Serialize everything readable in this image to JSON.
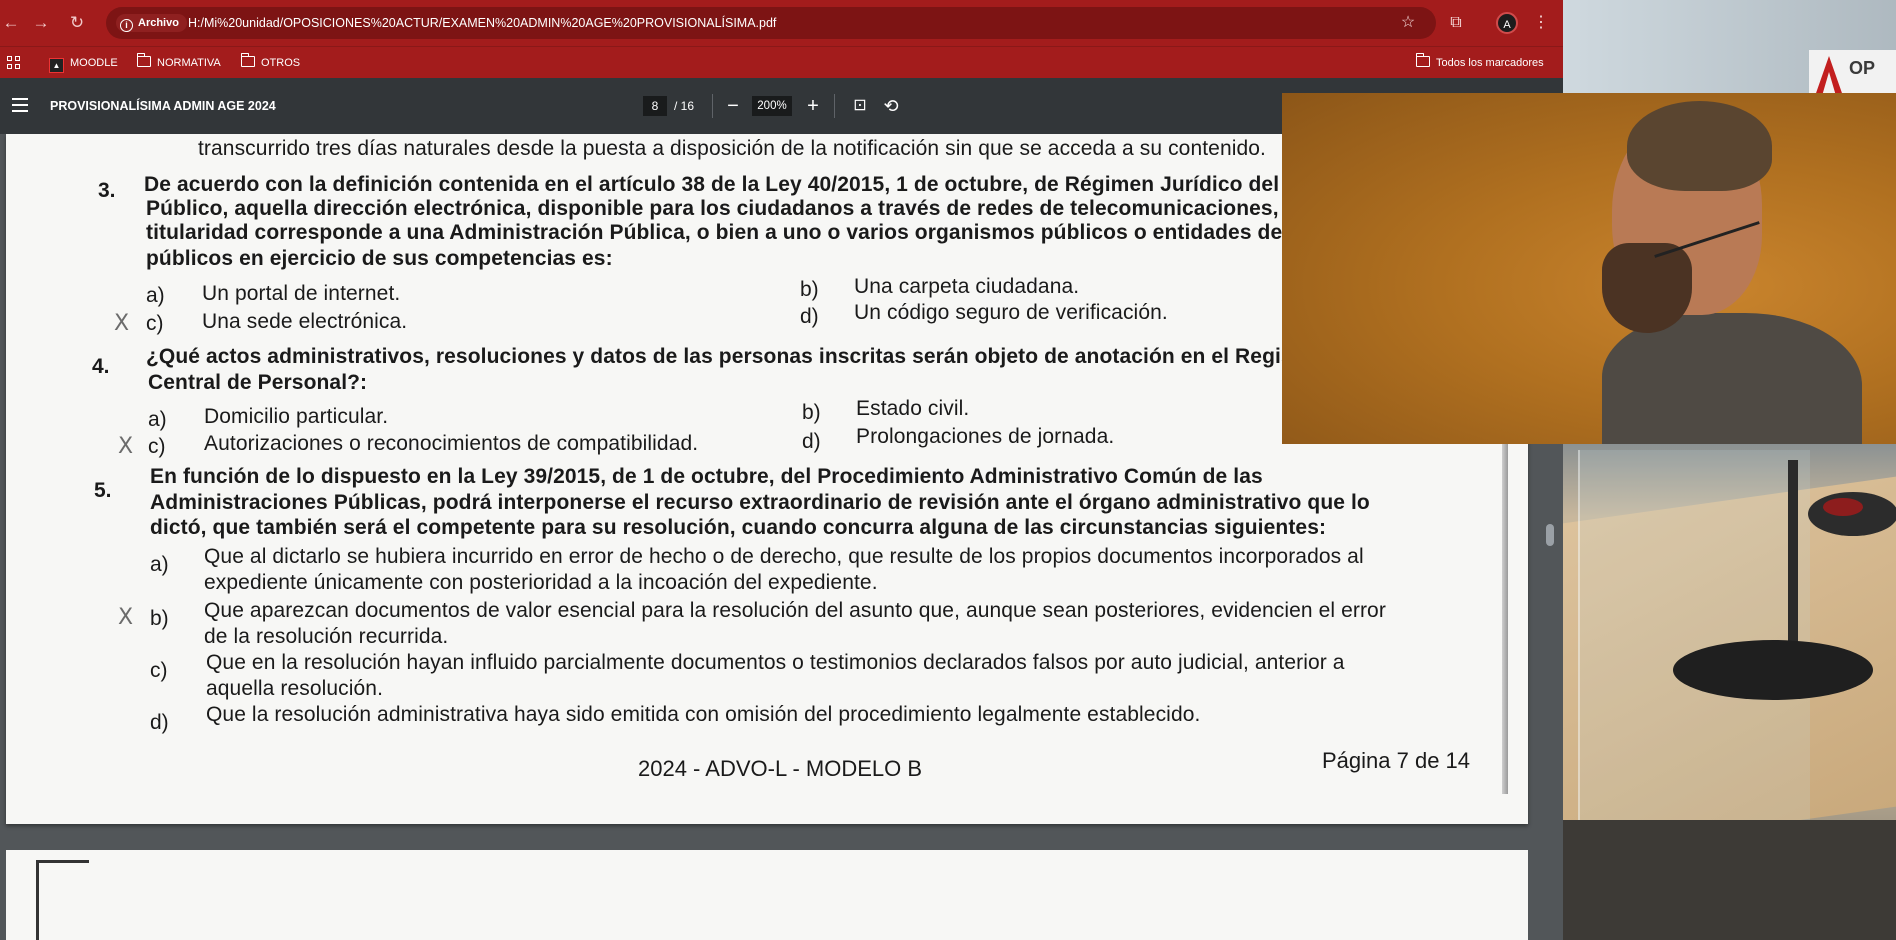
{
  "browser": {
    "url_chip": "Archivo",
    "url": "H:/Mi%20unidad/OPOSICIONES%20ACTUR/EXAMEN%20ADMIN%20AGE%20PROVISIONALÍSIMA.pdf",
    "icons": [
      "back-icon",
      "forward-icon",
      "reload-icon",
      "info-icon",
      "star-icon",
      "extensions-icon",
      "profile-icon",
      "menu-icon"
    ],
    "profile_initial": "A"
  },
  "bookmarks": {
    "items": [
      {
        "label": "MOODLE",
        "icon": "moodle-icon"
      },
      {
        "label": "NORMATIVA",
        "icon": "folder-icon"
      },
      {
        "label": "OTROS",
        "icon": "folder-icon"
      }
    ],
    "all_bookmarks": "Todos los marcadores"
  },
  "pdf_toolbar": {
    "title": "PROVISIONALÍSIMA ADMIN AGE 2024",
    "current_page": "8",
    "total_pages": "/ 16",
    "zoom": "200%",
    "icons": [
      "hamburger-icon",
      "zoom-out-icon",
      "zoom-in-icon",
      "fit-page-icon",
      "rotate-icon"
    ]
  },
  "document": {
    "prev_line": "transcurrido tres días naturales desde la puesta a disposición de la notificación sin que se acceda a su contenido.",
    "q3": {
      "number": "3.",
      "lines": [
        "De acuerdo con la definición contenida en el artículo 38 de la Ley 40/2015, 1 de octubre, de Régimen Jurídico del Sector",
        "Público, aquella dirección electrónica, disponible para los ciudadanos a través de redes de telecomunicaciones, cuya",
        "titularidad corresponde a una Administración Pública, o bien a uno o varios organismos públicos o entidades de Derecho",
        "públicos en ejercicio de sus competencias es:"
      ],
      "options": [
        {
          "letter": "a)",
          "text": "Un portal de internet."
        },
        {
          "letter": "b)",
          "text": "Una carpeta ciudadana."
        },
        {
          "letter": "c)",
          "text": "Una sede electrónica."
        },
        {
          "letter": "d)",
          "text": "Un código seguro de verificación."
        }
      ],
      "mark": "X"
    },
    "q4": {
      "number": "4.",
      "lines": [
        "¿Qué actos administrativos, resoluciones y datos de las personas inscritas serán objeto de anotación en el Registro",
        "Central de Personal?:"
      ],
      "options": [
        {
          "letter": "a)",
          "text": "Domicilio particular."
        },
        {
          "letter": "b)",
          "text": "Estado civil."
        },
        {
          "letter": "c)",
          "text": "Autorizaciones o reconocimientos de compatibilidad."
        },
        {
          "letter": "d)",
          "text": "Prolongaciones de jornada."
        }
      ],
      "mark": "X"
    },
    "q5": {
      "number": "5.",
      "lines": [
        "En función de lo dispuesto en la Ley 39/2015, de 1 de octubre, del Procedimiento Administrativo Común de las",
        "Administraciones Públicas, podrá interponerse el recurso extraordinario de revisión ante el órgano administrativo que lo",
        "dictó, que también será el competente para su resolución, cuando concurra alguna de las circunstancias siguientes:"
      ],
      "options": [
        {
          "letter": "a)",
          "lines": [
            "Que al dictarlo se hubiera incurrido en error de hecho o de derecho, que resulte de los propios documentos incorporados al",
            "expediente únicamente con posterioridad a la incoación del expediente."
          ]
        },
        {
          "letter": "b)",
          "lines": [
            "Que aparezcan documentos de valor esencial para la resolución del asunto que, aunque sean posteriores, evidencien el error",
            "de la resolución recurrida."
          ]
        },
        {
          "letter": "c)",
          "lines": [
            "Que en la resolución hayan influido parcialmente documentos o testimonios declarados falsos por auto judicial, anterior a",
            "aquella resolución."
          ]
        },
        {
          "letter": "d)",
          "lines": [
            "Que la resolución administrativa haya sido emitida con omisión del procedimiento legalmente establecido."
          ]
        }
      ],
      "mark": "X"
    },
    "footer": {
      "center": "2024 - ADVO-L - MODELO B",
      "right": "Página 7 de 14"
    }
  },
  "studio": {
    "sign_text": "OP"
  }
}
